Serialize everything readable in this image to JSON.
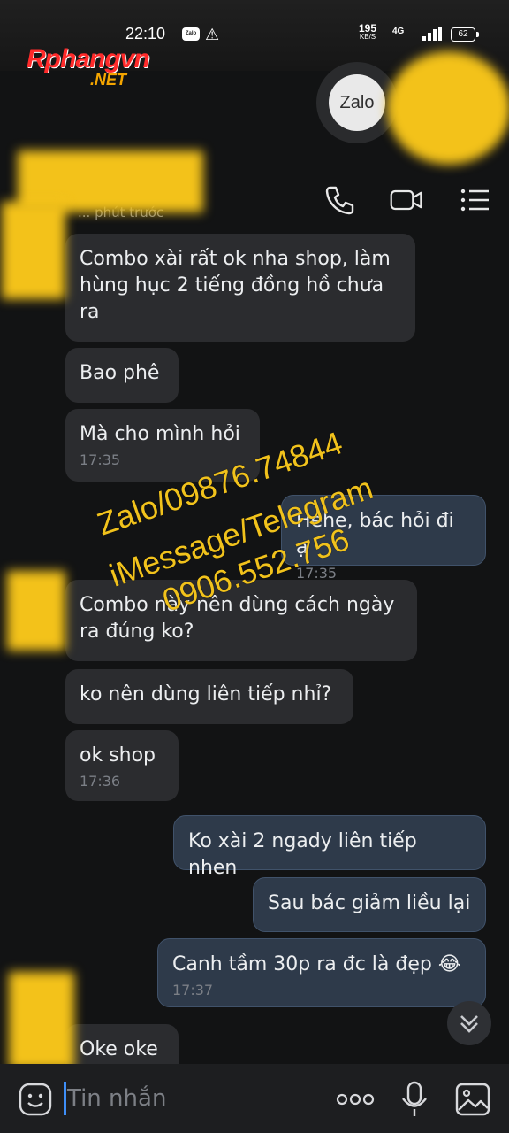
{
  "status_bar": {
    "time": "22:10",
    "app_icon": "Zalo",
    "net_speed_value": "195",
    "net_speed_unit": "KB/S",
    "network": "4G",
    "battery": "62"
  },
  "watermark": {
    "brand": "Rphangvn",
    "tld": ".NET"
  },
  "zalo_badge": {
    "label": "Zalo"
  },
  "header": {
    "last_seen": "... phút trước"
  },
  "overlay_text": {
    "line1": "Zalo/09876.74844",
    "line2": "iMessage/Telegram",
    "line3": "0906.552.756"
  },
  "messages": [
    {
      "direction": "in",
      "text": "Combo xài rất ok nha shop, làm hùng hục 2 tiếng đồng hồ chưa ra",
      "time": ""
    },
    {
      "direction": "in",
      "text": "Bao phê",
      "time": ""
    },
    {
      "direction": "in",
      "text": "Mà cho mình hỏi",
      "time": "17:35"
    },
    {
      "direction": "out",
      "text": "Hehe, bác hỏi đi ạ",
      "time": "17:35"
    },
    {
      "direction": "in",
      "text": "Combo này nên dùng cách ngày ra đúng ko?",
      "time": ""
    },
    {
      "direction": "in",
      "text": "ko nên dùng liên tiếp nhỉ?",
      "time": ""
    },
    {
      "direction": "in",
      "text": "ok shop",
      "time": "17:36"
    },
    {
      "direction": "out",
      "text": "Ko xài 2 ngady liên tiếp nhen",
      "time": ""
    },
    {
      "direction": "out",
      "text": "Sau bác giảm liều lại",
      "time": ""
    },
    {
      "direction": "out",
      "text": "Canh tầm 30p ra đc là đẹp 😂",
      "time": "17:37"
    },
    {
      "direction": "in",
      "text": "Oke oke",
      "time": ""
    }
  ],
  "composer": {
    "placeholder": "Tin nhắn"
  },
  "colors": {
    "background": "#121314",
    "incoming_bubble": "#2b2c2f",
    "outgoing_bubble": "#2e3a4a",
    "overlay_text": "#f1c21c",
    "cursor": "#3e8ef7"
  }
}
